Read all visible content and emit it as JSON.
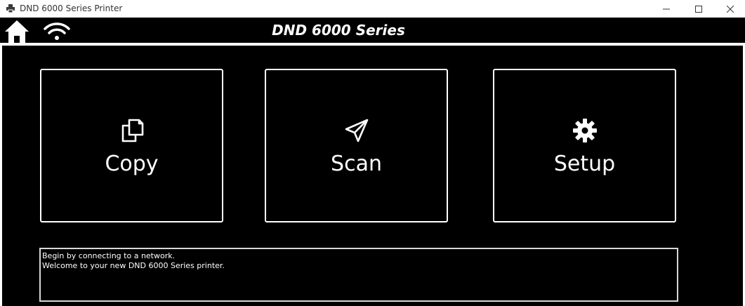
{
  "window": {
    "title": "DND 6000 Series Printer",
    "icon": "printer-app-icon",
    "controls": [
      "minimize-icon",
      "maximize-icon",
      "close-icon"
    ]
  },
  "header": {
    "title": "DND 6000 Series",
    "home_icon": "home-icon",
    "wifi_icon": "wifi-icon"
  },
  "tiles": [
    {
      "label": "Copy",
      "icon": "copy-icon"
    },
    {
      "label": "Scan",
      "icon": "paper-plane-icon"
    },
    {
      "label": "Setup",
      "icon": "gear-icon"
    }
  ],
  "status": {
    "lines": [
      "Begin by connecting to a network.",
      "Welcome to your new DND 6000 Series printer."
    ]
  },
  "colors": {
    "background": "#000000",
    "foreground": "#ffffff",
    "status_border": "#d8d8d8"
  }
}
